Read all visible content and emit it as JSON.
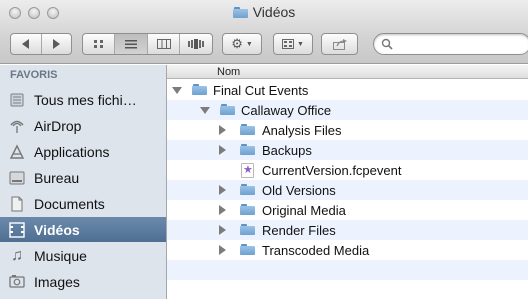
{
  "window": {
    "title": "Vidéos",
    "title_icon": "folder-icon"
  },
  "toolbar": {
    "back_icon": "chevron-left-icon",
    "forward_icon": "chevron-right-icon",
    "view_modes": [
      "icon-view",
      "list-view",
      "column-view",
      "coverflow-view"
    ],
    "active_view": "list-view",
    "action_icon": "gear-icon",
    "arrange_icon": "arrange-icon",
    "share_icon": "share-icon",
    "search_placeholder": ""
  },
  "sidebar": {
    "header": "FAVORIS",
    "items": [
      {
        "label": "Tous mes fichi…",
        "icon": "all-files-icon"
      },
      {
        "label": "AirDrop",
        "icon": "airdrop-icon"
      },
      {
        "label": "Applications",
        "icon": "applications-icon"
      },
      {
        "label": "Bureau",
        "icon": "desktop-icon"
      },
      {
        "label": "Documents",
        "icon": "documents-icon"
      },
      {
        "label": "Vidéos",
        "icon": "movies-icon",
        "selected": true
      },
      {
        "label": "Musique",
        "icon": "music-icon"
      },
      {
        "label": "Images",
        "icon": "pictures-icon"
      }
    ]
  },
  "list": {
    "column_header": "Nom",
    "rows": [
      {
        "label": "Final Cut Events",
        "kind": "folder",
        "expanded": true
      },
      {
        "label": "Callaway Office",
        "kind": "folder",
        "expanded": true
      },
      {
        "label": "Analysis Files",
        "kind": "folder",
        "expanded": false
      },
      {
        "label": "Backups",
        "kind": "folder",
        "expanded": false
      },
      {
        "label": "CurrentVersion.fcpevent",
        "kind": "file"
      },
      {
        "label": "Old Versions",
        "kind": "folder",
        "expanded": false
      },
      {
        "label": "Original Media",
        "kind": "folder",
        "expanded": false
      },
      {
        "label": "Render Files",
        "kind": "folder",
        "expanded": false
      },
      {
        "label": "Transcoded Media",
        "kind": "folder",
        "expanded": false
      }
    ]
  },
  "colors": {
    "sidebar_bg": "#dde4ec",
    "selection": "#5b7b9f",
    "alt_row": "#edf3fe"
  }
}
